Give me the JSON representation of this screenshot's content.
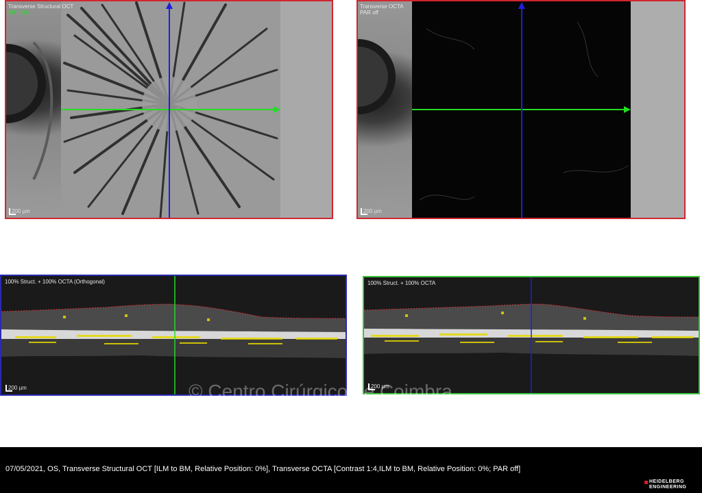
{
  "panels": {
    "structural": {
      "title": "Transverse Structural OCT",
      "subtitle": "ART 100",
      "scale": "200 µm",
      "border_color": "#d0262e"
    },
    "octa": {
      "title": "Transverse OCTA",
      "subtitle": "PAR off",
      "scale": "200 µm",
      "border_color": "#d0262e"
    },
    "bscan_left": {
      "title": "100% Struct. + 100% OCTA (Orthogonal)",
      "scale": "200 µm",
      "border_color": "#2a2ab0"
    },
    "bscan_right": {
      "title": "100% Struct. + 100% OCTA",
      "scale": "200 µm",
      "border_color": "#3cc43c"
    }
  },
  "watermark": "© Centro Cirúrgico de Coimbra",
  "footer": {
    "caption": "07/05/2021, OS, Transverse Structural OCT [ILM to BM, Relative Position: 0%], Transverse OCTA [Contrast 1:4,ILM to BM, Relative Position: 0%; PAR off]",
    "brand_line1": "HEIDELBERG",
    "brand_line2": "ENGINEERING"
  },
  "colors": {
    "green_line": "#22dd22",
    "blue_line": "#1f1fe0",
    "yellow_flow": "#e6d800",
    "red_boundary": "#e23030"
  },
  "icons": {
    "arrow_up": "arrow-up-icon",
    "arrow_right": "arrow-right-icon"
  }
}
